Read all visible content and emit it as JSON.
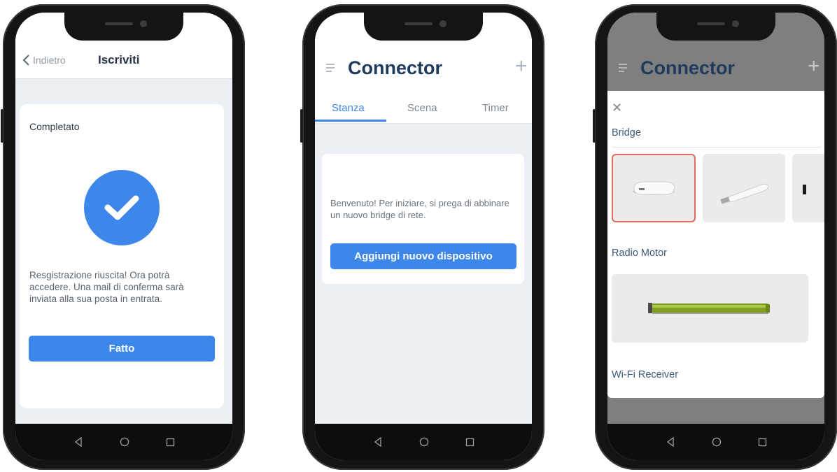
{
  "phone1": {
    "header": {
      "back_label": "Indietro",
      "title": "Iscriviti"
    },
    "card": {
      "heading": "Completato",
      "message": "Resgistrazione riuscita! Ora potrà accedere. Una mail di conferma sarà inviata alla sua posta in entrata.",
      "done_label": "Fatto"
    }
  },
  "phone2": {
    "appbar": {
      "title": "Connector"
    },
    "tabs": [
      {
        "label": "Stanza",
        "active": true
      },
      {
        "label": "Scena",
        "active": false
      },
      {
        "label": "Timer",
        "active": false
      }
    ],
    "card": {
      "message": "Benvenuto! Per iniziare, si prega di abbinare un nuovo bridge di rete.",
      "add_label": "Aggiungi nuovo dispositivo"
    }
  },
  "phone3": {
    "appbar": {
      "title": "Connector"
    },
    "sheet": {
      "sections": [
        {
          "label": "Bridge"
        },
        {
          "label": "Radio Motor"
        },
        {
          "label": "Wi-Fi Receiver"
        }
      ]
    }
  },
  "colors": {
    "accent": "#3d86ea",
    "title": "#1f3a5d",
    "selected_border": "#e36a62"
  },
  "icons": [
    "chevron-left-icon",
    "menu-icon",
    "plus-icon",
    "close-icon",
    "check-icon",
    "back-triangle-icon",
    "home-circle-icon",
    "recents-square-icon"
  ]
}
